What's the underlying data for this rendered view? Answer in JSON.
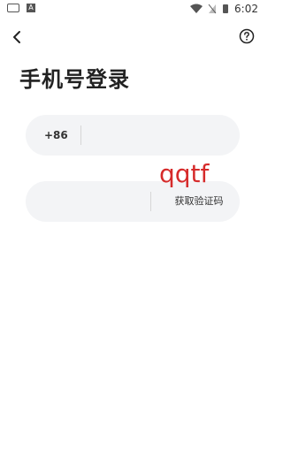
{
  "status": {
    "time": "6:02"
  },
  "header": {
    "title": "手机号登录"
  },
  "phone": {
    "country_code": "+86",
    "value": "",
    "placeholder": ""
  },
  "code": {
    "value": "",
    "placeholder": "",
    "get_code_label": "获取验证码"
  },
  "overlay": {
    "text": "qqtf",
    "color": "#d62b2b"
  }
}
